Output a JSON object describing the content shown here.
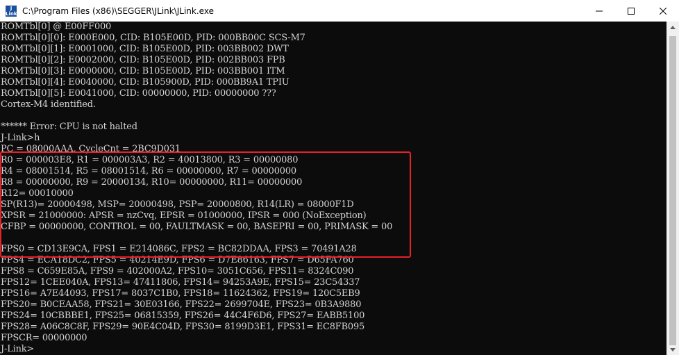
{
  "window": {
    "title": "C:\\Program Files (x86)\\SEGGER\\JLink\\JLink.exe",
    "icon_label": "J\nLink"
  },
  "console": {
    "lines": [
      "ROMTbl[0] @ E00FF000",
      "ROMTbl[0][0]: E000E000, CID: B105E00D, PID: 000BB00C SCS-M7",
      "ROMTbl[0][1]: E0001000, CID: B105E00D, PID: 003BB002 DWT",
      "ROMTbl[0][2]: E0002000, CID: B105E00D, PID: 002BB003 FPB",
      "ROMTbl[0][3]: E0000000, CID: B105E00D, PID: 003BB001 ITM",
      "ROMTbl[0][4]: E0040000, CID: B105900D, PID: 000BB9A1 TPIU",
      "ROMTbl[0][5]: E0041000, CID: 00000000, PID: 00000000 ???",
      "Cortex-M4 identified.",
      "",
      "****** Error: CPU is not halted",
      "J-Link>h",
      "PC = 08000AAA, CycleCnt = 2BC9D031",
      "R0 = 000003E8, R1 = 000003A3, R2 = 40013800, R3 = 00000080",
      "R4 = 08001514, R5 = 08001514, R6 = 00000000, R7 = 00000000",
      "R8 = 00000000, R9 = 20000134, R10= 00000000, R11= 00000000",
      "R12= 00010000",
      "SP(R13)= 20000498, MSP= 20000498, PSP= 20000800, R14(LR) = 08000F1D",
      "XPSR = 21000000: APSR = nzCvq, EPSR = 01000000, IPSR = 000 (NoException)",
      "CFBP = 00000000, CONTROL = 00, FAULTMASK = 00, BASEPRI = 00, PRIMASK = 00",
      "",
      "FPS0 = CD13E9CA, FPS1 = E214086C, FPS2 = BC82DDAA, FPS3 = 70491A28",
      "FPS4 = ECA18DC2, FPS5 = 40214E9D, FPS6 = D7E86163, FPS7 = D65FA760",
      "FPS8 = C659E85A, FPS9 = 402000A2, FPS10= 3051C656, FPS11= 8324C090",
      "FPS12= 1CEE040A, FPS13= 47411806, FPS14= 94253A9E, FPS15= 23C54337",
      "FPS16= A7E44093, FPS17= 8037C1B0, FPS18= 11624362, FPS19= 120C5EB9",
      "FPS20= B0CEAA58, FPS21= 30E03166, FPS22= 2699704E, FPS23= 0B3A9880",
      "FPS24= 10CBBBE1, FPS25= 06815359, FPS26= 44C4F6D6, FPS27= EABB5100",
      "FPS28= A06C8C8F, FPS29= 90E4C04D, FPS30= 8199D3E1, FPS31= EC8FB095",
      "FPSCR= 00000000",
      "J-Link>"
    ]
  },
  "colors": {
    "console_bg": "#0c0c0c",
    "console_text": "#d4d4d4",
    "highlight": "#e8202a"
  }
}
